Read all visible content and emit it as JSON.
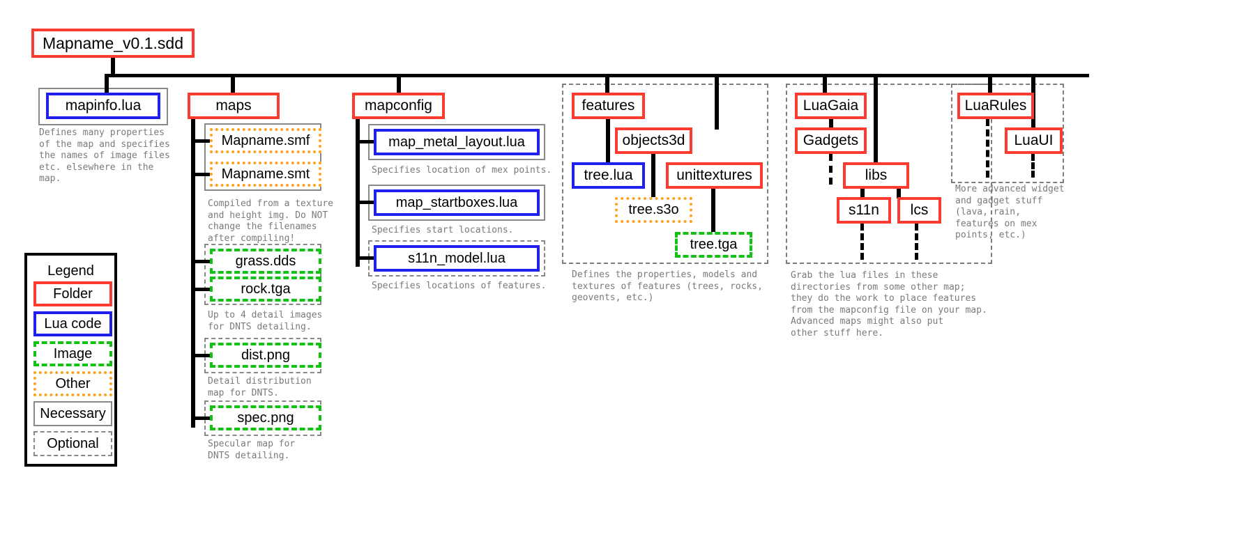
{
  "diagram": {
    "title": "Mapname_v0.1.sdd",
    "root": {
      "label": "Mapname_v0.1.sdd",
      "type": "folder"
    },
    "columns": [
      {
        "name": "mapinfo",
        "root": {
          "label": "mapinfo.lua",
          "type": "lua",
          "wrapper": "necessary"
        },
        "caption": "Defines many properties\nof the map and specifies\nthe names of image files\netc. elsewhere in the\nmap."
      },
      {
        "name": "maps",
        "root": {
          "label": "maps",
          "type": "folder"
        },
        "children": [
          {
            "label": "Mapname.smf",
            "type": "other"
          },
          {
            "label": "Mapname.smt",
            "type": "other"
          },
          {
            "label": "grass.dds",
            "type": "image"
          },
          {
            "label": "rock.tga",
            "type": "image"
          },
          {
            "label": "dist.png",
            "type": "image"
          },
          {
            "label": "spec.png",
            "type": "image"
          }
        ],
        "captions": [
          "Compiled from a texture\nand height img. Do NOT\nchange the filenames\nafter compiling!",
          "Up to 4 detail images\nfor DNTS detailing.",
          "Detail distribution\nmap for DNTS.",
          "Specular map for\nDNTS detailing."
        ]
      },
      {
        "name": "mapconfig",
        "root": {
          "label": "mapconfig",
          "type": "folder"
        },
        "children": [
          {
            "label": "map_metal_layout.lua",
            "type": "lua",
            "wrapper": "necessary"
          },
          {
            "label": "map_startboxes.lua",
            "type": "lua",
            "wrapper": "necessary"
          },
          {
            "label": "s11n_model.lua",
            "type": "lua",
            "wrapper": "optional"
          }
        ],
        "captions": [
          "Specifies location of mex points.",
          "Specifies start locations.",
          "Specifies locations of features."
        ]
      },
      {
        "name": "features",
        "root": {
          "label": "features",
          "type": "folder"
        },
        "children": [
          {
            "label": "objects3d",
            "type": "folder"
          },
          {
            "label": "tree.lua",
            "type": "lua"
          },
          {
            "label": "unittextures",
            "type": "folder"
          },
          {
            "label": "tree.s3o",
            "type": "other"
          },
          {
            "label": "tree.tga",
            "type": "image"
          }
        ],
        "caption": "Defines the properties, models and\ntextures of features (trees, rocks,\ngeovents, etc.)"
      },
      {
        "name": "luagaia",
        "root": {
          "label": "LuaGaia",
          "type": "folder"
        },
        "children": [
          {
            "label": "Gadgets",
            "type": "folder"
          },
          {
            "label": "libs",
            "type": "folder"
          },
          {
            "label": "s11n",
            "type": "folder"
          },
          {
            "label": "lcs",
            "type": "folder"
          }
        ],
        "caption": "Grab the lua files in these\ndirectories from some other map;\nthey do the work to place features\nfrom the mapconfig file on your map.\nAdvanced maps might also put\nother stuff here."
      },
      {
        "name": "luarules",
        "root": {
          "label": "LuaRules",
          "type": "folder"
        },
        "children": [
          {
            "label": "LuaUI",
            "type": "folder"
          }
        ],
        "caption": "More advanced widget\nand gadget stuff\n(lava, rain,\nfeatures on mex\npoints, etc.)"
      }
    ]
  },
  "legend": {
    "title": "Legend",
    "items": [
      {
        "label": "Folder",
        "type": "folder"
      },
      {
        "label": "Lua code",
        "type": "lua"
      },
      {
        "label": "Image",
        "type": "image"
      },
      {
        "label": "Other",
        "type": "other"
      },
      {
        "label": "Necessary",
        "type": "necessary"
      },
      {
        "label": "Optional",
        "type": "optional"
      }
    ]
  },
  "colors": {
    "folder": "#ff3b30",
    "lua": "#2020ee",
    "image": "#12c212",
    "other": "#ffa220",
    "necessary": "#888888",
    "optional": "#888888",
    "connector": "#000000",
    "caption": "#7a7a7a"
  }
}
